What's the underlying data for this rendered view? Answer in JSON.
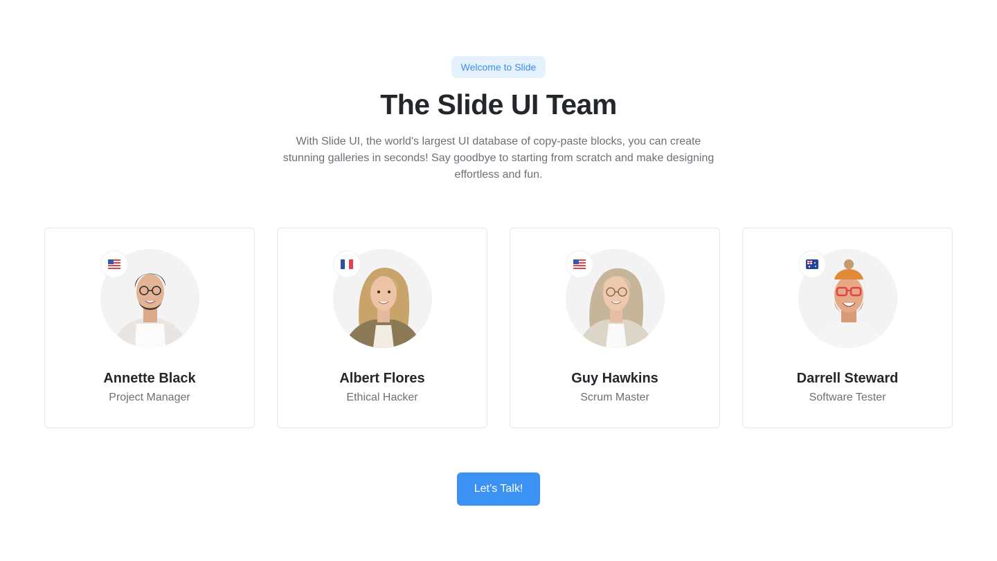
{
  "header": {
    "badge": "Welcome to Slide",
    "title": "The Slide UI Team",
    "subtitle": "With Slide UI, the world's largest UI database of copy-paste blocks, you can create stunning galleries in seconds! Say goodbye to starting from scratch and make designing effortless and fun."
  },
  "team": [
    {
      "name": "Annette Black",
      "role": "Project Manager",
      "flag_icon": "us-flag-icon"
    },
    {
      "name": "Albert Flores",
      "role": "Ethical Hacker",
      "flag_icon": "france-flag-icon"
    },
    {
      "name": "Guy Hawkins",
      "role": "Scrum Master",
      "flag_icon": "us-flag-icon"
    },
    {
      "name": "Darrell Steward",
      "role": "Software Tester",
      "flag_icon": "australia-flag-icon"
    }
  ],
  "cta": {
    "label": "Let’s Talk!"
  },
  "colors": {
    "accent": "#3c92f3",
    "badge_bg": "#e6f1fe",
    "badge_text": "#3b8ee9",
    "heading": "#23262b",
    "muted": "#6b6f76"
  }
}
